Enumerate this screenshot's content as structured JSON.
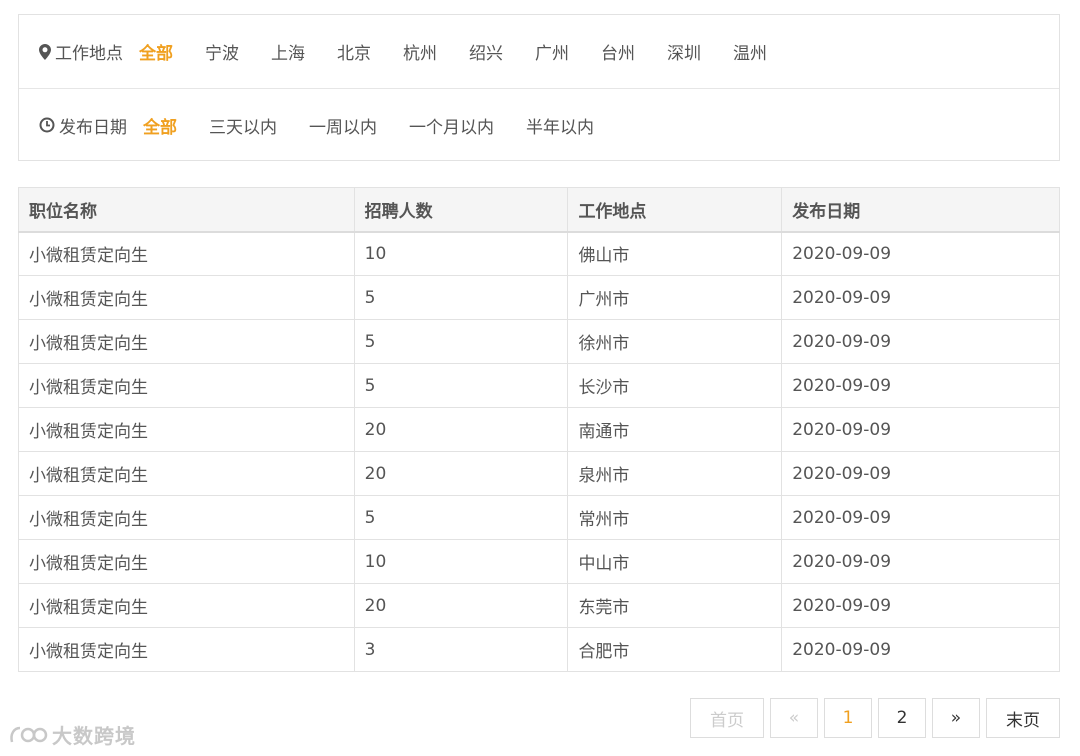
{
  "filters": {
    "location": {
      "label": "工作地点",
      "options": [
        "全部",
        "宁波",
        "上海",
        "北京",
        "杭州",
        "绍兴",
        "广州",
        "台州",
        "深圳",
        "温州"
      ],
      "active": "全部"
    },
    "date": {
      "label": "发布日期",
      "options": [
        "全部",
        "三天以内",
        "一周以内",
        "一个月以内",
        "半年以内"
      ],
      "active": "全部"
    }
  },
  "table": {
    "headers": [
      "职位名称",
      "招聘人数",
      "工作地点",
      "发布日期"
    ],
    "rows": [
      [
        "小微租赁定向生",
        "10",
        "佛山市",
        "2020-09-09"
      ],
      [
        "小微租赁定向生",
        "5",
        "广州市",
        "2020-09-09"
      ],
      [
        "小微租赁定向生",
        "5",
        "徐州市",
        "2020-09-09"
      ],
      [
        "小微租赁定向生",
        "5",
        "长沙市",
        "2020-09-09"
      ],
      [
        "小微租赁定向生",
        "20",
        "南通市",
        "2020-09-09"
      ],
      [
        "小微租赁定向生",
        "20",
        "泉州市",
        "2020-09-09"
      ],
      [
        "小微租赁定向生",
        "5",
        "常州市",
        "2020-09-09"
      ],
      [
        "小微租赁定向生",
        "10",
        "中山市",
        "2020-09-09"
      ],
      [
        "小微租赁定向生",
        "20",
        "东莞市",
        "2020-09-09"
      ],
      [
        "小微租赁定向生",
        "3",
        "合肥市",
        "2020-09-09"
      ]
    ]
  },
  "pagination": {
    "first": "首页",
    "prev": "«",
    "pages": [
      "1",
      "2"
    ],
    "current": "1",
    "next": "»",
    "last": "末页"
  },
  "watermark": {
    "text": "大数跨境"
  },
  "colors": {
    "accent": "#f0a020",
    "text": "#555555",
    "border": "#e2e2e2",
    "header_bg": "#f5f5f5"
  }
}
